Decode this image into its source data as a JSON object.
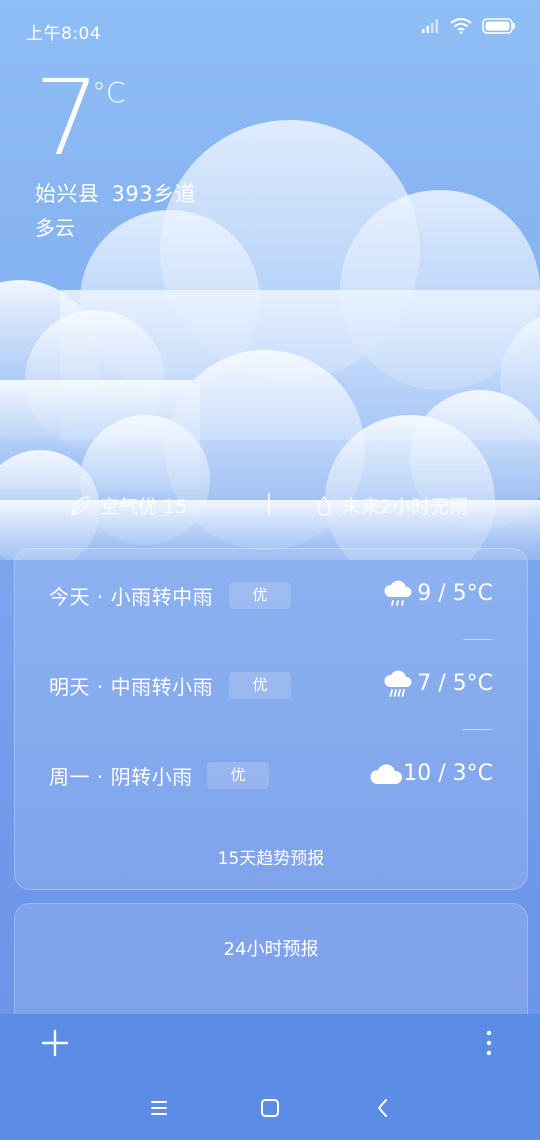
{
  "status_bar": {
    "time": "上午8:04",
    "icons": [
      "signal-icon",
      "wifi-icon",
      "battery-icon"
    ]
  },
  "current": {
    "temperature": "7",
    "unit": "°C",
    "location_county": "始兴县",
    "location_road": "393乡道",
    "condition": "多云"
  },
  "info": {
    "air_label": "空气优 15",
    "rain_label": "未来2小时无雨"
  },
  "forecast": {
    "days": [
      {
        "label": "今天 · 小雨转中雨",
        "quality": "优",
        "icon": "light-rain-icon",
        "temp": "9 / 5°C"
      },
      {
        "label": "明天 · 中雨转小雨",
        "quality": "优",
        "icon": "moderate-rain-icon",
        "temp": "7 / 5°C"
      },
      {
        "label": "周一 · 阴转小雨",
        "quality": "优",
        "icon": "cloudy-icon",
        "temp": "10 / 3°C"
      }
    ],
    "trend_button": "15天趋势预报"
  },
  "hourly": {
    "title": "24小时预报"
  },
  "toolbar": {
    "add_icon": "plus-icon",
    "more_icon": "more-vertical-icon"
  },
  "nav": {
    "menu_icon": "menu-icon",
    "home_icon": "home-icon",
    "back_icon": "back-icon"
  }
}
